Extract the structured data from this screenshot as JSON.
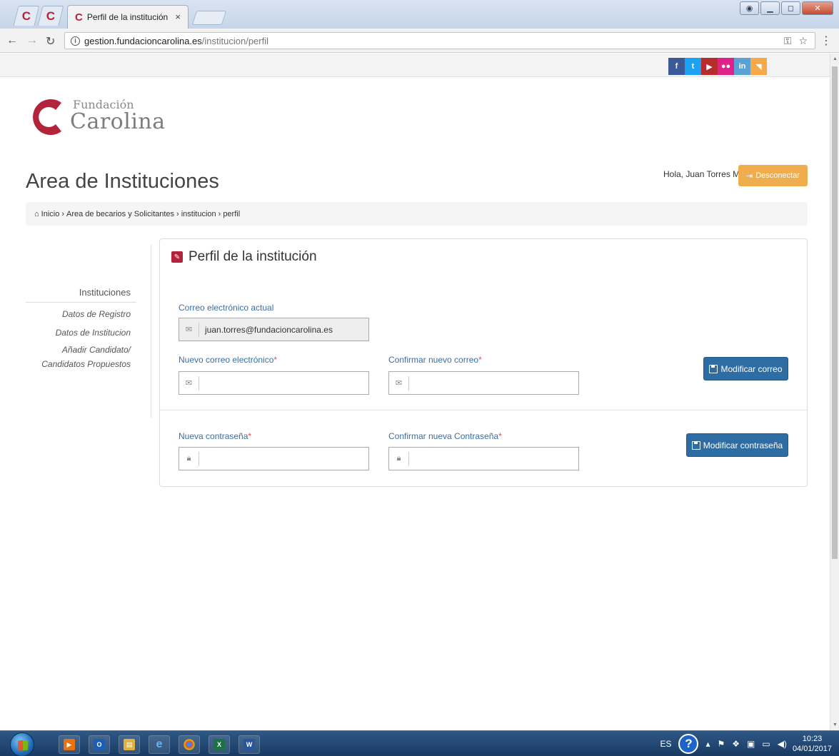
{
  "browser": {
    "tab_title": "Perfil de la institución",
    "tab_close": "×",
    "url_domain": "gestion.fundacioncarolina.es",
    "url_path": "/institucion/perfil"
  },
  "social": [
    "f",
    "t",
    "▶",
    "●●",
    "in",
    "◥"
  ],
  "logo": {
    "small": "Fundación",
    "big": "Carolina",
    "color": "#b3243b"
  },
  "header": {
    "title": "Area de Instituciones",
    "greeting": "Hola, Juan Torres M.",
    "logout_label": "Desconectar"
  },
  "breadcrumb": {
    "items": [
      "Inicio",
      "Area de becarios y Solicitantes",
      "institucion",
      "perfil"
    ],
    "sep": "›"
  },
  "sidebar": {
    "heading": "Instituciones",
    "links": [
      "Datos de Registro",
      "Datos de Institucion",
      "Añadir Candidato/",
      "Candidatos Propuestos"
    ]
  },
  "profile": {
    "title": "Perfil de la institución",
    "current_email_label": "Correo electrónico actual",
    "current_email_value": "juan.torres@fundacioncarolina.es",
    "new_email_label": "Nuevo correo electrónico",
    "confirm_email_label": "Confirmar nuevo correo",
    "modify_email_button": "Modificar correo",
    "new_password_label": "Nueva contraseña",
    "confirm_password_label": "Confirmar nueva Contraseña",
    "modify_password_button": "Modificar contraseña",
    "required_mark": "*"
  },
  "taskbar": {
    "language": "ES",
    "time": "10:23",
    "date": "04/01/2017"
  },
  "colors": {
    "accent": "#b3243b",
    "primary": "#2e6da4",
    "warning": "#f0ad4e"
  }
}
